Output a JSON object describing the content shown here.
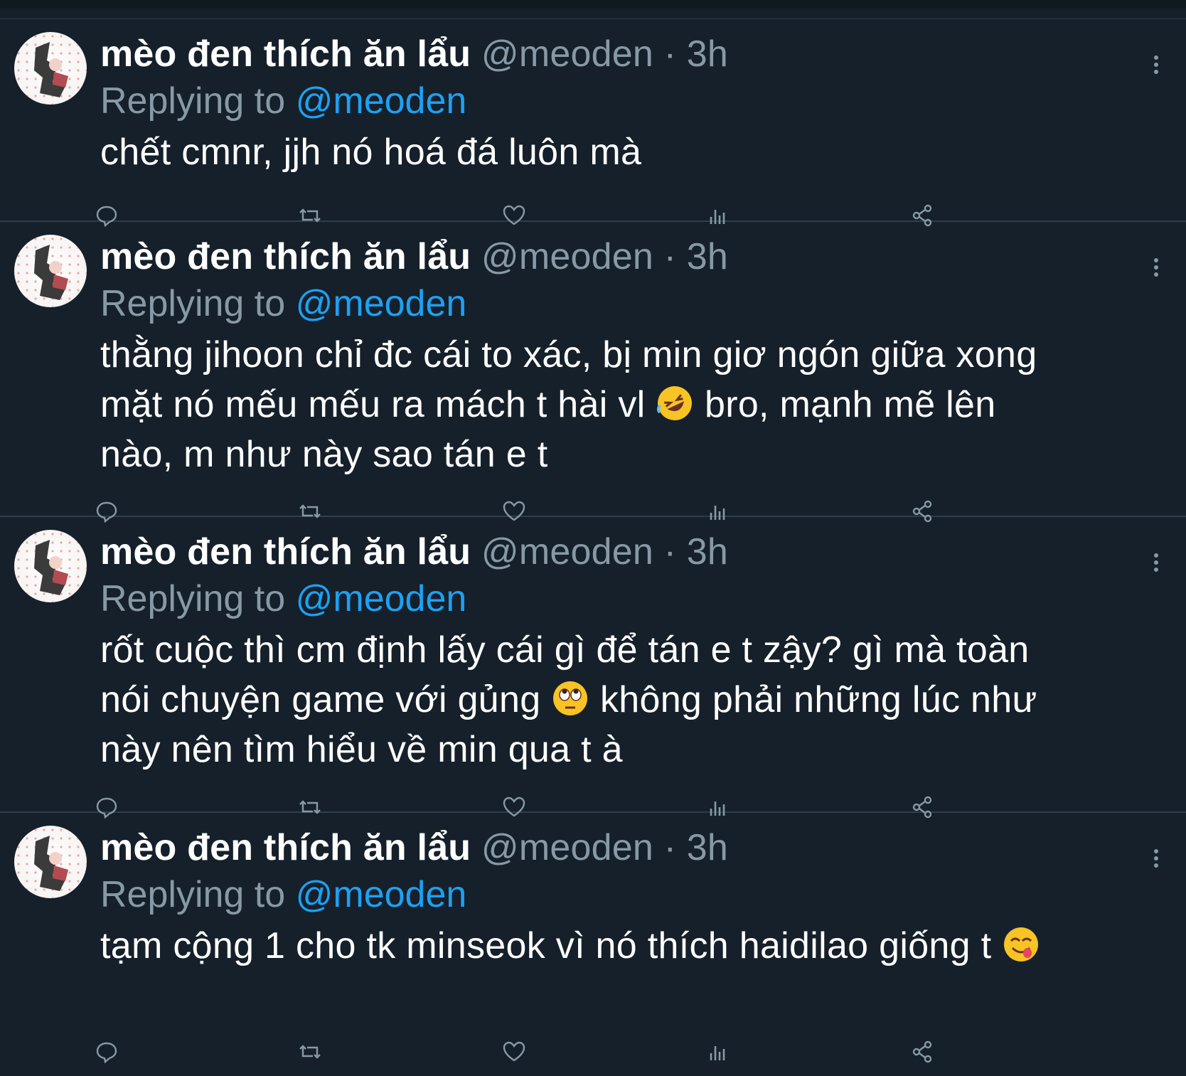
{
  "colors": {
    "background": "#15202b",
    "divider": "#2f3e4d",
    "text": "#ffffff",
    "muted": "#8899a6",
    "link": "#1da1f2"
  },
  "tweets": [
    {
      "name": "mèo đen thích ăn lẩu",
      "handle": "@meoden",
      "separator": "·",
      "time": "3h",
      "replying_prefix": "Replying to",
      "replying_handle": "@meoden",
      "body": [
        "chết cmnr, jjh nó hoá đá luôn mà"
      ]
    },
    {
      "name": "mèo đen thích ăn lẩu",
      "handle": "@meoden",
      "separator": "·",
      "time": "3h",
      "replying_prefix": "Replying to",
      "replying_handle": "@meoden",
      "body": [
        "thằng jihoon chỉ đc cái to xác, bị min giơ ngón giữa xong",
        "mặt nó mếu mếu ra mách t hài vl ",
        " bro, mạnh mẽ lên",
        "nào, m như này sao tán e t"
      ],
      "emoji": "rolling-on-floor-laughing-emoji"
    },
    {
      "name": "mèo đen thích ăn lẩu",
      "handle": "@meoden",
      "separator": "·",
      "time": "3h",
      "replying_prefix": "Replying to",
      "replying_handle": "@meoden",
      "body": [
        "rốt cuộc thì cm định lấy cái gì để tán e t zậy? gì mà toàn",
        "nói chuyện game với gủng ",
        " không phải những lúc như",
        "này nên tìm hiểu về min qua t à"
      ],
      "emoji": "face-with-rolling-eyes-emoji"
    },
    {
      "name": "mèo đen thích ăn lẩu",
      "handle": "@meoden",
      "separator": "·",
      "time": "3h",
      "replying_prefix": "Replying to",
      "replying_handle": "@meoden",
      "body": [
        "tạm cộng 1 cho tk minseok vì nó thích haidilao giống t "
      ],
      "emoji": "face-savoring-food-emoji"
    }
  ],
  "action_icons": [
    "reply-icon",
    "retweet-icon",
    "like-icon",
    "analytics-icon",
    "share-icon"
  ]
}
